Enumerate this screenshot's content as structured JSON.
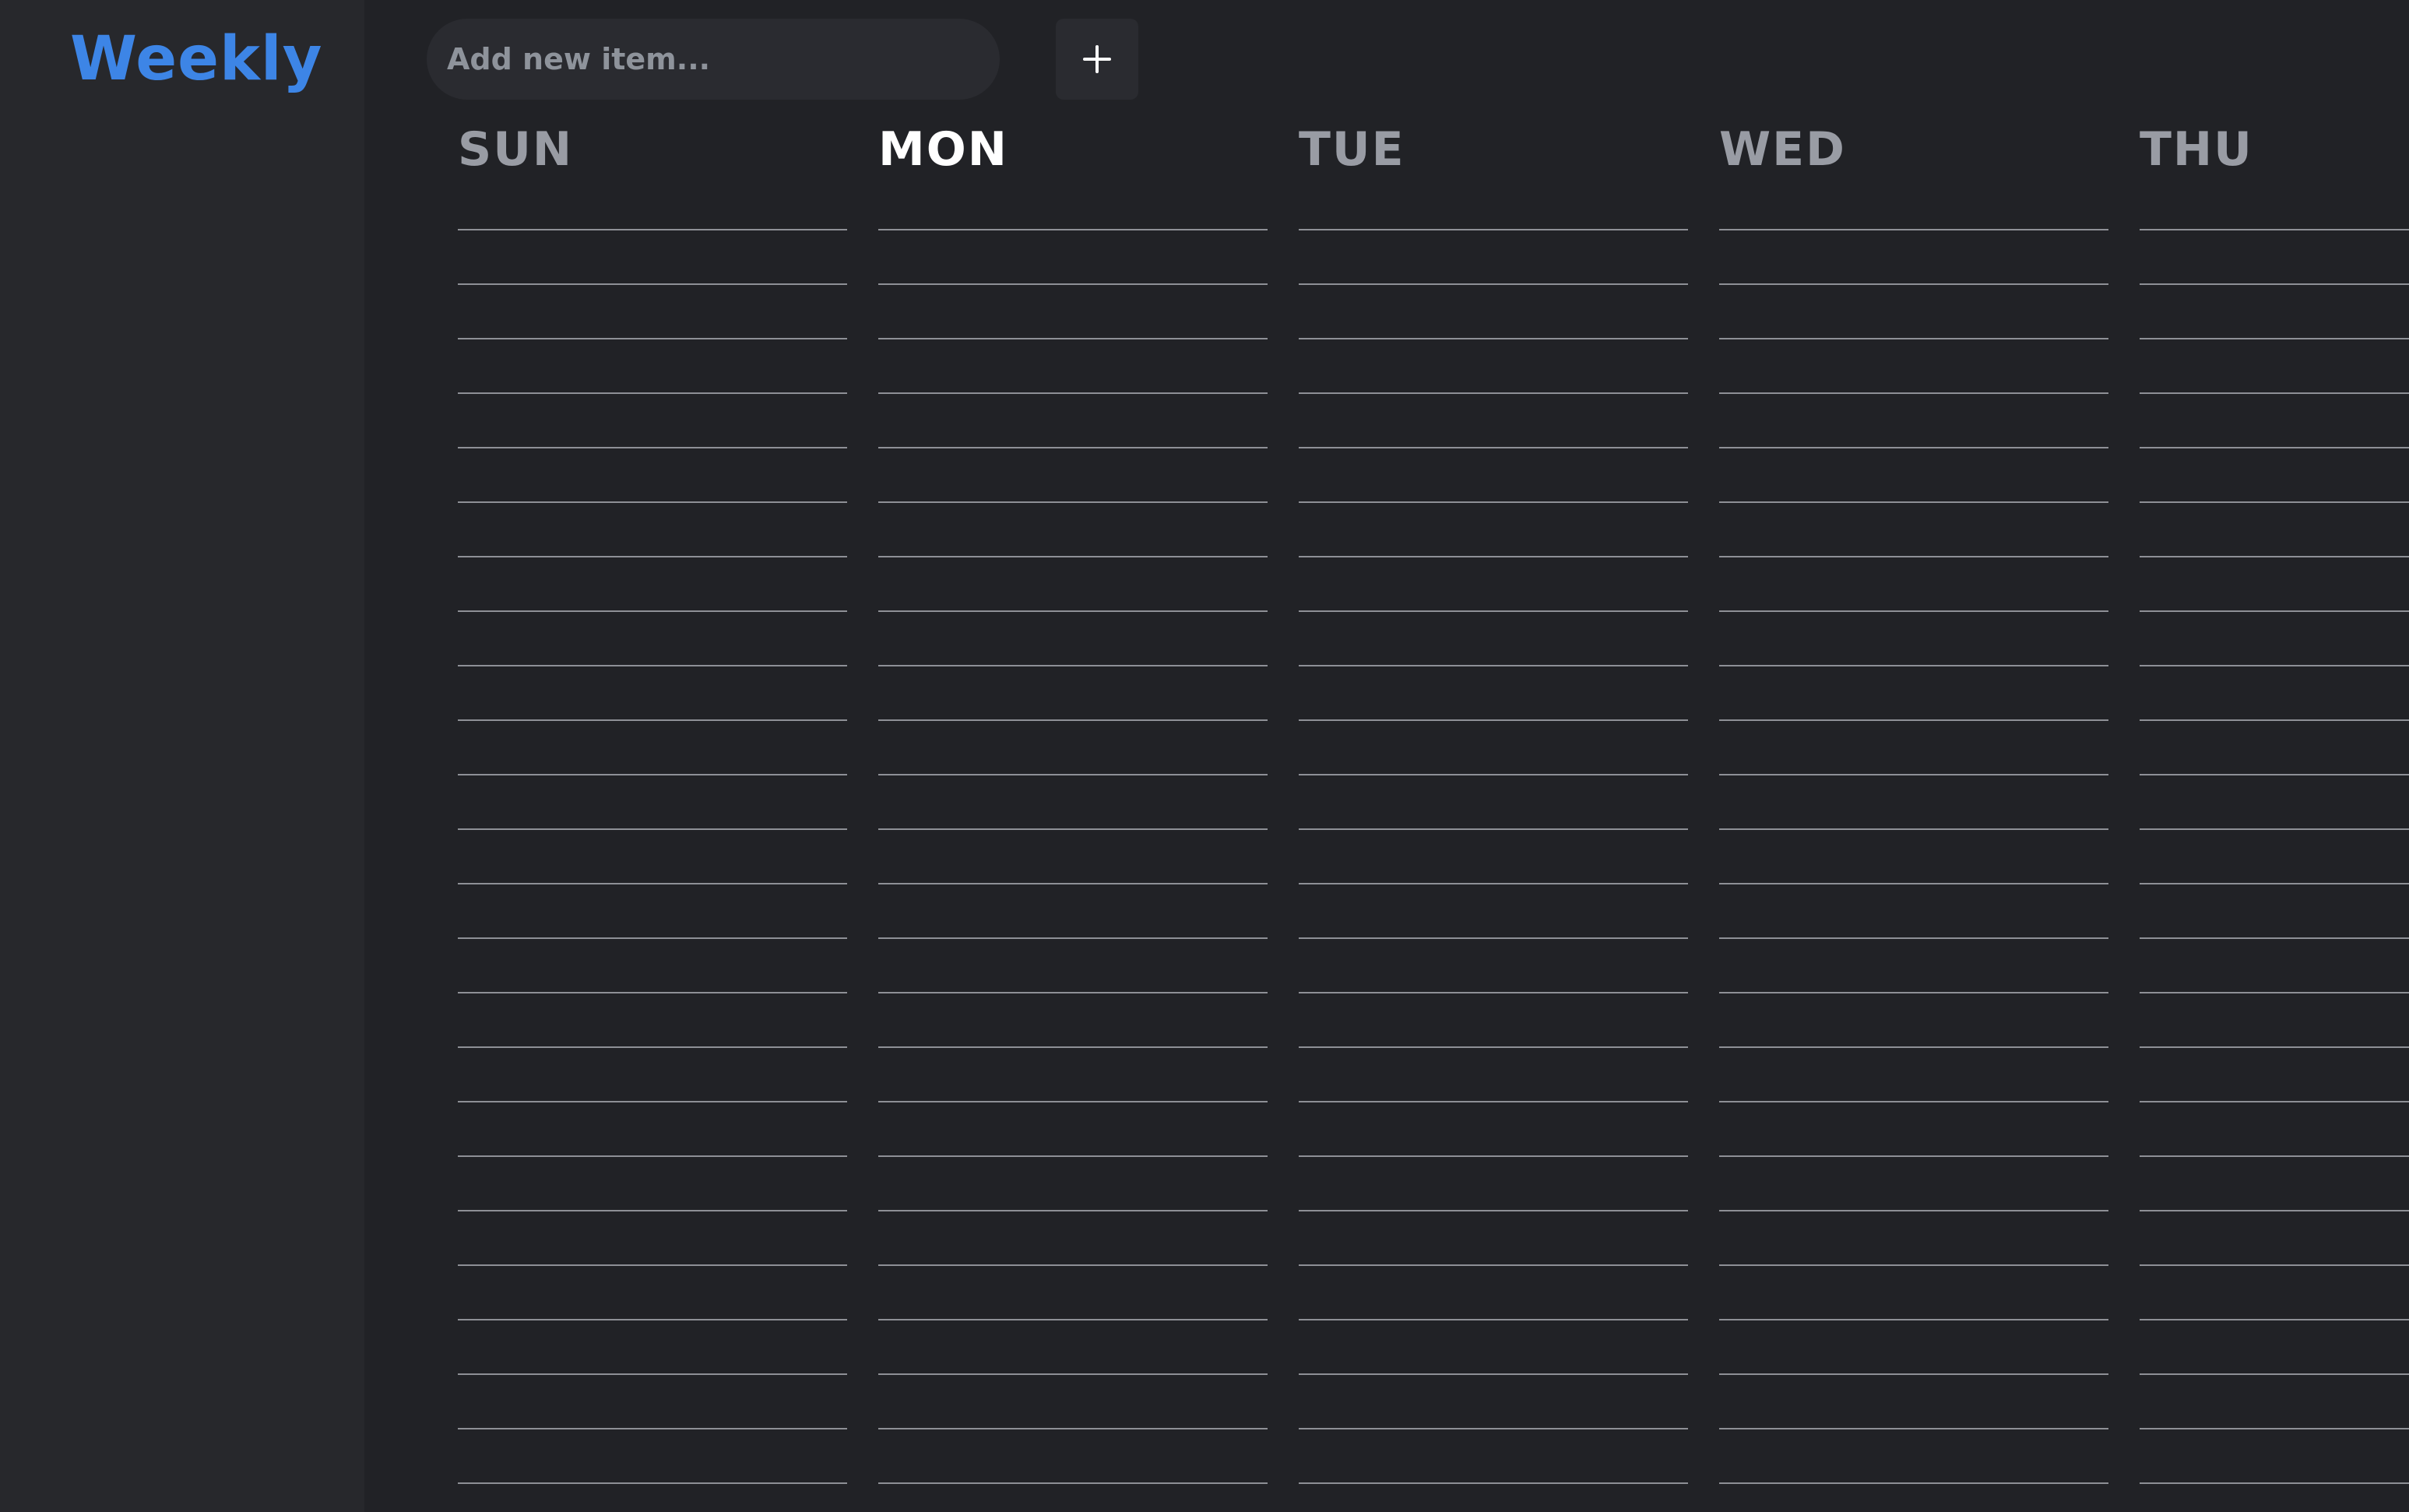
{
  "app": {
    "title": "Weekly"
  },
  "toolbar": {
    "input_placeholder": "Add new item...",
    "input_value": "",
    "add_button_icon": "plus-icon"
  },
  "days": [
    {
      "label": "SUN",
      "today": false
    },
    {
      "label": "MON",
      "today": true
    },
    {
      "label": "TUE",
      "today": false
    },
    {
      "label": "WED",
      "today": false
    },
    {
      "label": "THU",
      "today": false
    }
  ],
  "colors": {
    "brand": "#3d85e6",
    "background": "#212226",
    "sidebar": "#27282c",
    "header_inactive": "#999ca4",
    "header_today": "#ffffff",
    "line": "#8e9096"
  }
}
